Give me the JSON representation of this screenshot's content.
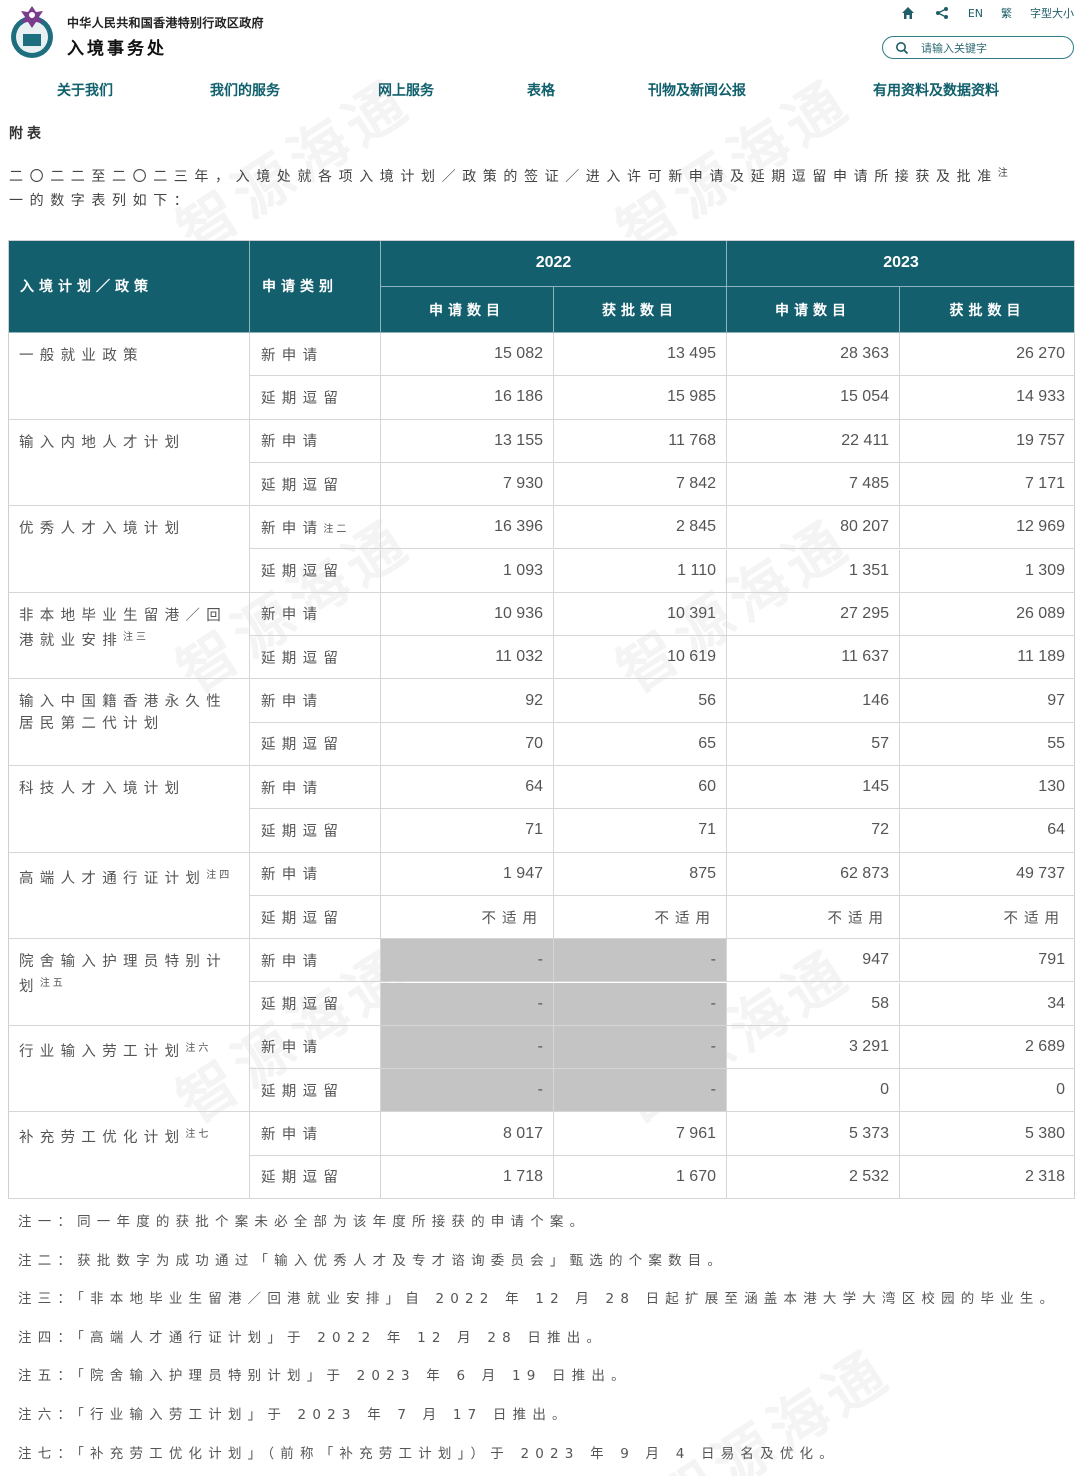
{
  "header": {
    "gov_name": "中华人民共和国香港特别行政区政府",
    "dept_name": "入境事务处",
    "lang_en": "EN",
    "lang_tc": "繁",
    "font_size": "字型大小",
    "search_placeholder": "请输入关键字",
    "icons": [
      "home-icon",
      "share-icon",
      "search-icon"
    ]
  },
  "nav": [
    "关于我们",
    "我们的服务",
    "网上服务",
    "表格",
    "刊物及新闻公报",
    "有用资料及数据资料"
  ],
  "appendix_title": "附表",
  "intro": {
    "line1": "二〇二二至二〇二三年，入境处就各项入境计划／政策的签证／进入许可新申请及延期逗留申请所接获及批准",
    "note_mark": "注",
    "line2": "一的数字表列如下："
  },
  "table": {
    "header_program": "入境计划／政策",
    "header_type": "申请类别",
    "year_2022": "2022",
    "year_2023": "2023",
    "applications": "申请数目",
    "approved": "获批数目",
    "rows": [
      {
        "program": "一般就业政策",
        "note": "",
        "type": "新申请",
        "type_note": "",
        "a22": "15 082",
        "b22": "13 495",
        "a23": "28 363",
        "b23": "26 270"
      },
      {
        "type": "延期逗留",
        "type_note": "",
        "a22": "16 186",
        "b22": "15 985",
        "a23": "15 054",
        "b23": "14 933"
      },
      {
        "program": "输入内地人才计划",
        "note": "",
        "type": "新申请",
        "type_note": "",
        "a22": "13 155",
        "b22": "11 768",
        "a23": "22 411",
        "b23": "19 757"
      },
      {
        "type": "延期逗留",
        "type_note": "",
        "a22": "7 930",
        "b22": "7 842",
        "a23": "7 485",
        "b23": "7 171"
      },
      {
        "program": "优秀人才入境计划",
        "note": "",
        "type": "新申请",
        "type_note": "注二",
        "a22": "16 396",
        "b22": "2 845",
        "a23": "80 207",
        "b23": "12 969"
      },
      {
        "type": "延期逗留",
        "type_note": "",
        "a22": "1 093",
        "b22": "1 110",
        "a23": "1 351",
        "b23": "1 309"
      },
      {
        "program": "非本地毕业生留港／回港就业安排",
        "note": "注三",
        "type": "新申请",
        "type_note": "",
        "a22": "10 936",
        "b22": "10 391",
        "a23": "27 295",
        "b23": "26 089"
      },
      {
        "type": "延期逗留",
        "type_note": "",
        "a22": "11 032",
        "b22": "10 619",
        "a23": "11 637",
        "b23": "11 189"
      },
      {
        "program": "输入中国籍香港永久性居民第二代计划",
        "note": "",
        "type": "新申请",
        "type_note": "",
        "a22": "92",
        "b22": "56",
        "a23": "146",
        "b23": "97"
      },
      {
        "type": "延期逗留",
        "type_note": "",
        "a22": "70",
        "b22": "65",
        "a23": "57",
        "b23": "55"
      },
      {
        "program": "科技人才入境计划",
        "note": "",
        "type": "新申请",
        "type_note": "",
        "a22": "64",
        "b22": "60",
        "a23": "145",
        "b23": "130"
      },
      {
        "type": "延期逗留",
        "type_note": "",
        "a22": "71",
        "b22": "71",
        "a23": "72",
        "b23": "64"
      },
      {
        "program": "高端人才通行证计划",
        "note": "注四",
        "type": "新申请",
        "type_note": "",
        "a22": "1 947",
        "b22": "875",
        "a23": "62 873",
        "b23": "49 737"
      },
      {
        "type": "延期逗留",
        "type_note": "",
        "a22": "不适用",
        "b22": "不适用",
        "a23": "不适用",
        "b23": "不适用"
      },
      {
        "program": "院舍输入护理员特别计划",
        "note": "注五",
        "type": "新申请",
        "type_note": "",
        "a22": "-",
        "b22": "-",
        "a23": "947",
        "b23": "791"
      },
      {
        "type": "延期逗留",
        "type_note": "",
        "a22": "-",
        "b22": "-",
        "a23": "58",
        "b23": "34"
      },
      {
        "program": "行业输入劳工计划",
        "note": "注六",
        "type": "新申请",
        "type_note": "",
        "a22": "-",
        "b22": "-",
        "a23": "3 291",
        "b23": "2 689"
      },
      {
        "type": "延期逗留",
        "type_note": "",
        "a22": "-",
        "b22": "-",
        "a23": "0",
        "b23": "0"
      },
      {
        "program": "补充劳工优化计划",
        "note": "注七",
        "type": "新申请",
        "type_note": "",
        "a22": "8 017",
        "b22": "7 961",
        "a23": "5 373",
        "b23": "5 380"
      },
      {
        "type": "延期逗留",
        "type_note": "",
        "a22": "1 718",
        "b22": "1 670",
        "a23": "2 532",
        "b23": "2 318"
      }
    ]
  },
  "notes": [
    "注一：同一年度的获批个案未必全部为该年度所接获的申请个案。",
    "注二：获批数字为成功通过「输入优秀人才及专才谘询委员会」甄选的个案数目。",
    "注三：「非本地毕业生留港／回港就业安排」自 2022 年 12 月 28 日起扩展至涵盖本港大学大湾区校园的毕业生。",
    "注四：「高端人才通行证计划」于 2022 年 12 月 28 日推出。",
    "注五：「院舍输入护理员特别计划」于 2023 年 6 月 19 日推出。",
    "注六：「行业输入劳工计划」于 2023 年 7 月 17 日推出。",
    "注七：「补充劳工优化计划」（前称「补充劳工计划」）于 2023 年 9 月 4 日易名及优化。"
  ],
  "watermark": "智源海通",
  "colors": {
    "header_teal": "#145f6e",
    "nav_teal": "#0f5f6c",
    "na_gray": "#c4c4c4"
  }
}
